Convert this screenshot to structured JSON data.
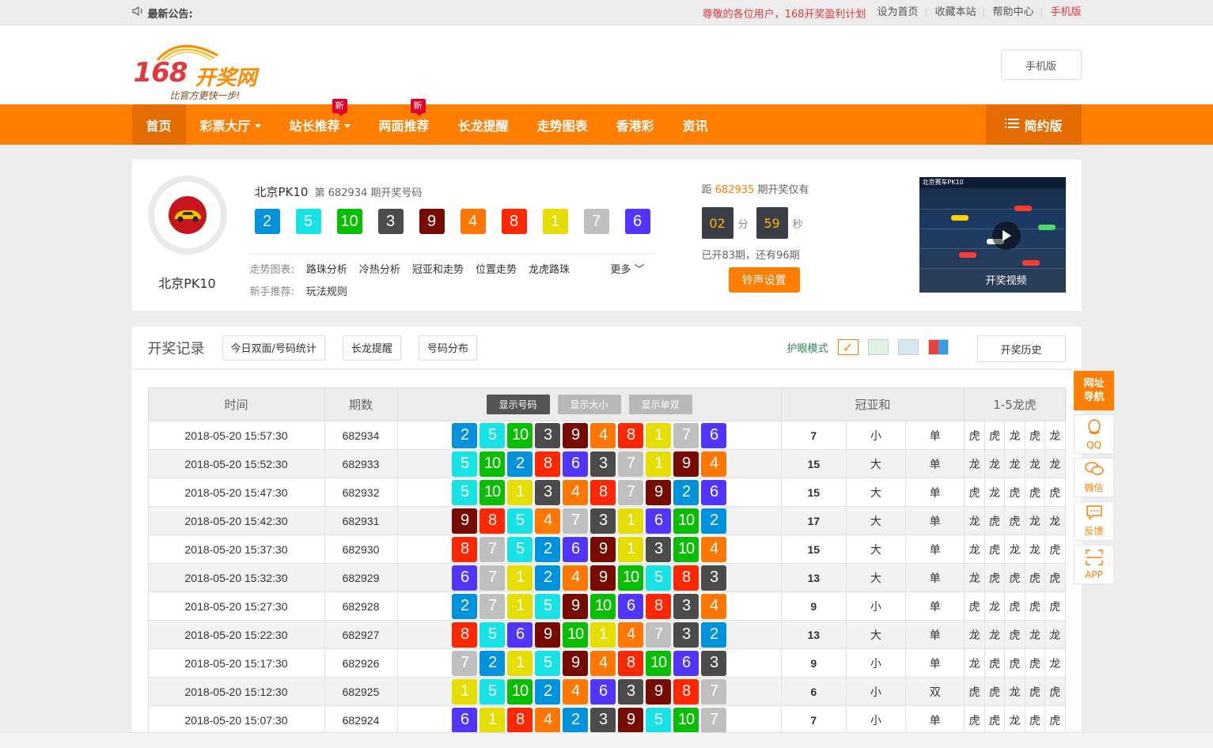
{
  "topbar": {
    "announcement_label": "最新公告:",
    "highlight": "尊敬的各位用户，168开奖盈利计划",
    "links": [
      "设为首页",
      "收藏本站",
      "帮助中心",
      "手机版"
    ]
  },
  "header": {
    "logo_number": "168",
    "logo_text": "开奖网",
    "logo_slogan": "比官方更快一步!",
    "mobile_button": "手机版"
  },
  "nav": {
    "items": [
      {
        "label": "首页"
      },
      {
        "label": "彩票大厅"
      },
      {
        "label": "站长推荐",
        "badge": "新"
      },
      {
        "label": "两面推荐",
        "badge": "新"
      },
      {
        "label": "长龙提醒"
      },
      {
        "label": "走势图表"
      },
      {
        "label": "香港彩"
      },
      {
        "label": "资讯"
      }
    ],
    "simple_label": "简约版"
  },
  "lottery": {
    "name": "北京PK10",
    "title": "北京PK10",
    "subtitle": "第 682934 期开奖号码",
    "balls": [
      2,
      5,
      10,
      3,
      9,
      4,
      8,
      1,
      7,
      6
    ],
    "trend_label": "走势图表:",
    "trend_links": [
      "路珠分析",
      "冷热分析",
      "冠亚和走势",
      "位置走势",
      "龙虎路珠"
    ],
    "more_label": "更多",
    "newbie_label": "新手推荐:",
    "newbie_link": "玩法规则",
    "countdown_prefix": "距",
    "countdown_issue": "682935",
    "countdown_suffix": "期开奖仅有",
    "minutes": "02",
    "minutes_unit": "分",
    "seconds": "59",
    "seconds_unit": "秒",
    "opened_text": "已开83期，还有96期",
    "ring_button": "铃声设置",
    "video_label": "开奖视频",
    "video_title": "北京赛车PK10"
  },
  "records": {
    "title": "开奖记录",
    "tabs": [
      "今日双面/号码统计",
      "长龙提醒",
      "号码分布"
    ],
    "eye_mode_label": "护眼模式",
    "history_button": "开奖历史",
    "columns": {
      "time": "时间",
      "issue": "期数",
      "sum": "冠亚和",
      "dragon_tiger": "1-5龙虎"
    },
    "view_buttons": [
      "显示号码",
      "显示大小",
      "显示单双"
    ],
    "rows": [
      {
        "time": "2018-05-20 15:57:30",
        "issue": "682934",
        "nums": [
          2,
          5,
          10,
          3,
          9,
          4,
          8,
          1,
          7,
          6
        ],
        "sum": "7",
        "size": "小",
        "parity": "单",
        "dt": [
          "虎",
          "虎",
          "龙",
          "虎",
          "龙"
        ]
      },
      {
        "time": "2018-05-20 15:52:30",
        "issue": "682933",
        "nums": [
          5,
          10,
          2,
          8,
          6,
          3,
          7,
          1,
          9,
          4
        ],
        "sum": "15",
        "size": "大",
        "parity": "单",
        "dt": [
          "龙",
          "龙",
          "龙",
          "龙",
          "龙"
        ]
      },
      {
        "time": "2018-05-20 15:47:30",
        "issue": "682932",
        "nums": [
          5,
          10,
          1,
          3,
          4,
          8,
          7,
          9,
          2,
          6
        ],
        "sum": "15",
        "size": "大",
        "parity": "单",
        "dt": [
          "虎",
          "龙",
          "虎",
          "虎",
          "虎"
        ]
      },
      {
        "time": "2018-05-20 15:42:30",
        "issue": "682931",
        "nums": [
          9,
          8,
          5,
          4,
          7,
          3,
          1,
          6,
          10,
          2
        ],
        "sum": "17",
        "size": "大",
        "parity": "单",
        "dt": [
          "龙",
          "虎",
          "虎",
          "龙",
          "龙"
        ]
      },
      {
        "time": "2018-05-20 15:37:30",
        "issue": "682930",
        "nums": [
          8,
          7,
          5,
          2,
          6,
          9,
          1,
          3,
          10,
          4
        ],
        "sum": "15",
        "size": "大",
        "parity": "单",
        "dt": [
          "龙",
          "虎",
          "龙",
          "龙",
          "虎"
        ]
      },
      {
        "time": "2018-05-20 15:32:30",
        "issue": "682929",
        "nums": [
          6,
          7,
          1,
          2,
          4,
          9,
          10,
          5,
          8,
          3
        ],
        "sum": "13",
        "size": "大",
        "parity": "单",
        "dt": [
          "龙",
          "虎",
          "虎",
          "虎",
          "虎"
        ]
      },
      {
        "time": "2018-05-20 15:27:30",
        "issue": "682928",
        "nums": [
          2,
          7,
          1,
          5,
          9,
          10,
          6,
          8,
          3,
          4
        ],
        "sum": "9",
        "size": "小",
        "parity": "单",
        "dt": [
          "虎",
          "龙",
          "虎",
          "虎",
          "虎"
        ]
      },
      {
        "time": "2018-05-20 15:22:30",
        "issue": "682927",
        "nums": [
          8,
          5,
          6,
          9,
          10,
          1,
          4,
          7,
          3,
          2
        ],
        "sum": "13",
        "size": "大",
        "parity": "单",
        "dt": [
          "龙",
          "龙",
          "虎",
          "龙",
          "龙"
        ]
      },
      {
        "time": "2018-05-20 15:17:30",
        "issue": "682926",
        "nums": [
          7,
          2,
          1,
          5,
          9,
          4,
          8,
          10,
          6,
          3
        ],
        "sum": "9",
        "size": "小",
        "parity": "单",
        "dt": [
          "龙",
          "虎",
          "虎",
          "虎",
          "龙"
        ]
      },
      {
        "time": "2018-05-20 15:12:30",
        "issue": "682925",
        "nums": [
          1,
          5,
          10,
          2,
          4,
          6,
          3,
          9,
          8,
          7
        ],
        "sum": "6",
        "size": "小",
        "parity": "双",
        "dt": [
          "虎",
          "虎",
          "龙",
          "虎",
          "虎"
        ]
      },
      {
        "time": "2018-05-20 15:07:30",
        "issue": "682924",
        "nums": [
          6,
          1,
          8,
          4,
          2,
          3,
          9,
          5,
          10,
          7
        ],
        "sum": "7",
        "size": "小",
        "parity": "单",
        "dt": [
          "虎",
          "虎",
          "龙",
          "虎",
          "虎"
        ]
      }
    ]
  },
  "side": {
    "top_label_1": "网址",
    "top_label_2": "导航",
    "items": [
      "QQ",
      "微信",
      "反馈",
      "APP"
    ]
  },
  "colors": {
    "accent": "#ff7d00",
    "ball_1": "#e6de00",
    "ball_2": "#0092dd",
    "ball_3": "#4b4b4b",
    "ball_4": "#ff7600",
    "ball_5": "#17e2e5",
    "ball_6": "#5234ff",
    "ball_7": "#bfbfbf",
    "ball_8": "#ff2600",
    "ball_9": "#780b00",
    "ball_10": "#07bf00"
  }
}
